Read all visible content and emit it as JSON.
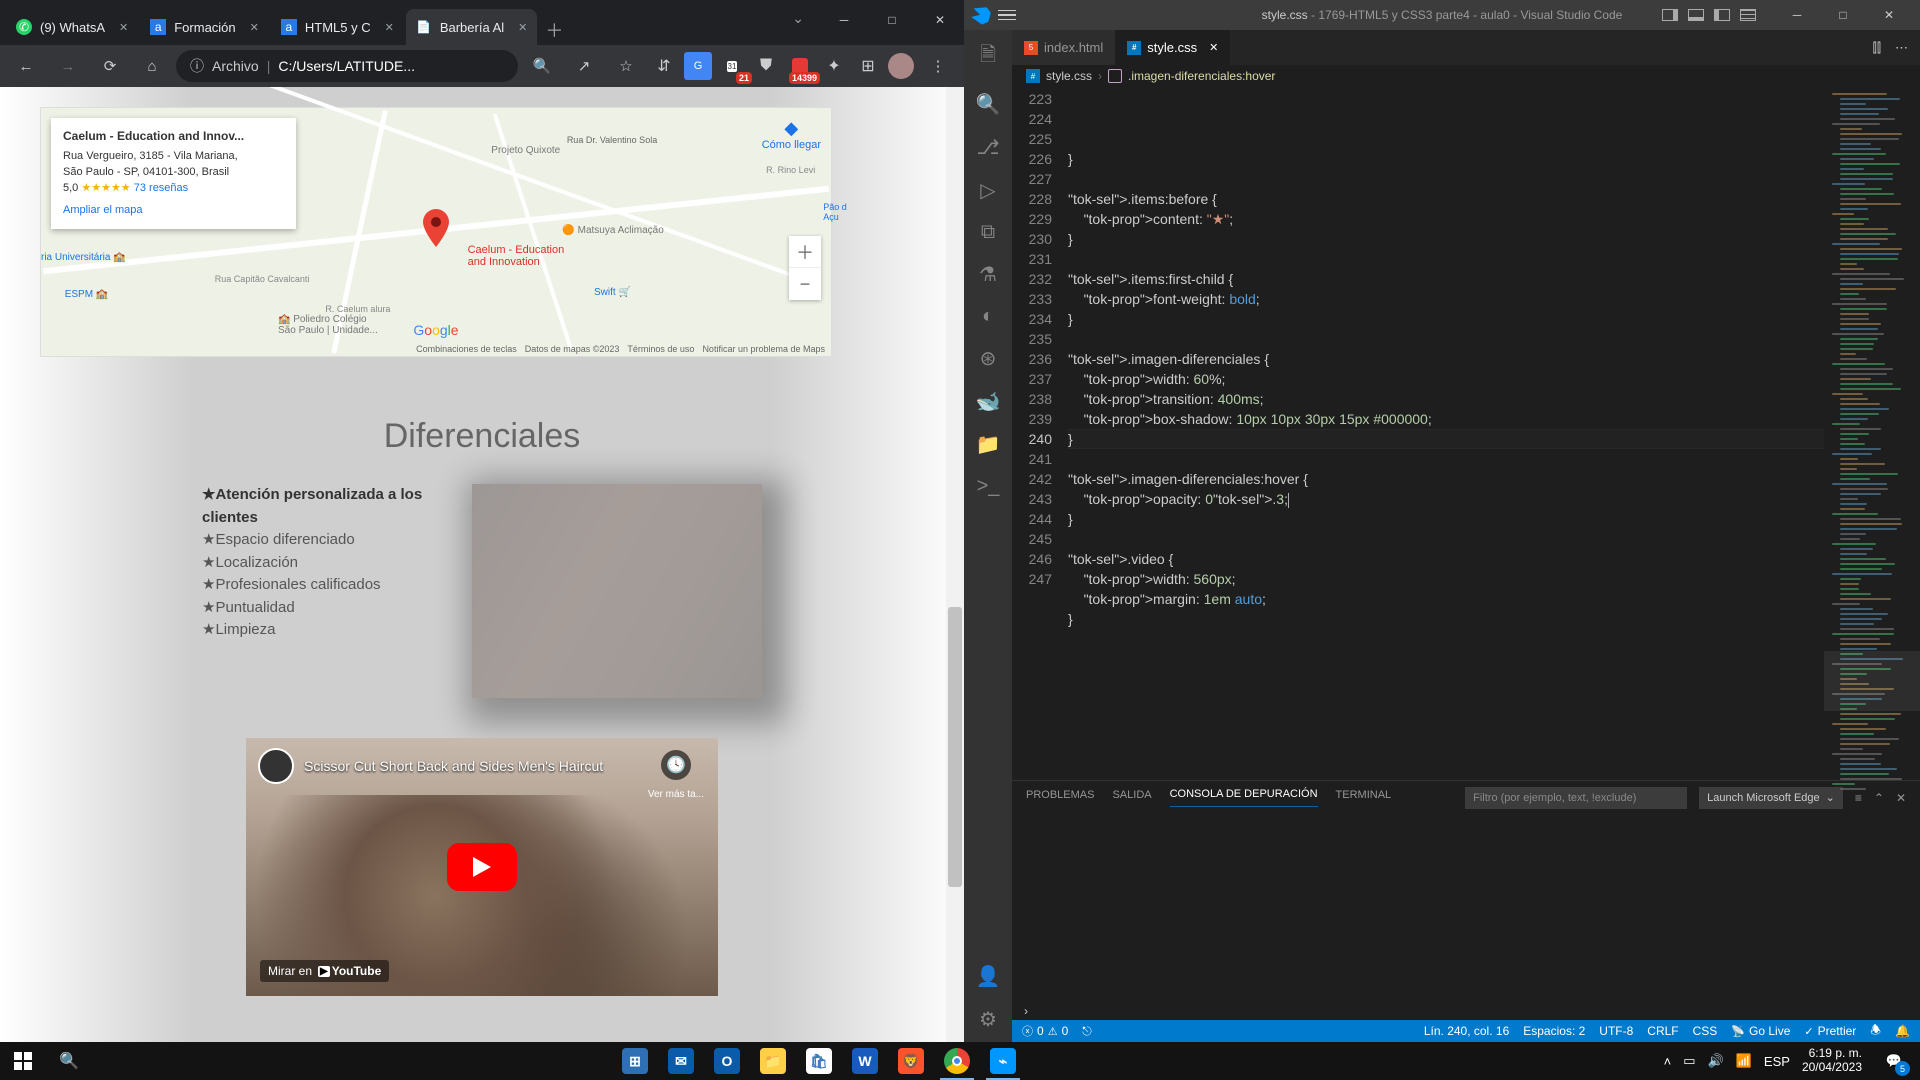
{
  "chrome": {
    "tabs": [
      {
        "title": "(9) WhatsA",
        "favicon": "green"
      },
      {
        "title": "Formación",
        "favicon": "alura"
      },
      {
        "title": "HTML5 y C",
        "favicon": "alura"
      },
      {
        "title": "Barbería Al",
        "favicon": "page",
        "active": true
      }
    ],
    "omnibox": {
      "prefix": "Archivo",
      "path": "C:/Users/LATITUDE..."
    },
    "ext_badges": {
      "cal": "21",
      "red": "14399"
    }
  },
  "page": {
    "map": {
      "card_title": "Caelum - Education and Innov...",
      "address1": "Rua Vergueiro, 3185 - Vila Mariana,",
      "address2": "São Paulo - SP, 04101-300, Brasil",
      "rating": "5,0",
      "reviews": "73 reseñas",
      "enlarge": "Ampliar el mapa",
      "directions": "Cómo llegar",
      "pin_label": "Caelum - Education\nand Innovation",
      "footer1": "Combinaciones de teclas",
      "footer2": "Datos de mapas ©2023",
      "footer3": "Términos de uso",
      "footer4": "Notificar un problema de Maps"
    },
    "dif_title": "Diferenciales",
    "items": [
      "Atención personalizada a los clientes",
      "Espacio diferenciado",
      "Localización",
      "Profesionales calificados",
      "Puntualidad",
      "Limpieza"
    ],
    "video": {
      "title": "Scissor Cut Short Back and Sides Men's Haircut",
      "later": "Ver más ta...",
      "watch": "Mirar en"
    }
  },
  "vscode": {
    "title": {
      "file": "style.css",
      "project": "1769-HTML5 y CSS3 parte4 - aula0",
      "app": "Visual Studio Code"
    },
    "tabs": [
      {
        "name": "index.html",
        "icon": "html"
      },
      {
        "name": "style.css",
        "icon": "css",
        "active": true,
        "close": true
      }
    ],
    "breadcrumb": {
      "file": "style.css",
      "selector": ".imagen-diferenciales:hover"
    },
    "code": {
      "start": 223,
      "lines": [
        "}",
        "",
        ".items:before {",
        "    content: \"★\";",
        "}",
        "",
        ".items:first-child {",
        "    font-weight: bold;",
        "}",
        "",
        ".imagen-diferenciales {",
        "    width: 60%;",
        "    transition: 400ms;",
        "    box-shadow: 10px 10px 30px 15px #000000;",
        "}",
        "",
        ".imagen-diferenciales:hover {",
        "    opacity: 0.3;",
        "}",
        "",
        ".video {",
        "    width: 560px;",
        "    margin: 1em auto;",
        "}",
        ""
      ],
      "current_line": 240
    },
    "panel": {
      "tabs": [
        "PROBLEMAS",
        "SALIDA",
        "CONSOLA DE DEPURACIÓN",
        "TERMINAL"
      ],
      "active_tab": "CONSOLA DE DEPURACIÓN",
      "filter_placeholder": "Filtro (por ejemplo, text, !exclude)",
      "launch": "Launch Microsoft Edge"
    },
    "status": {
      "errors": "0",
      "warnings": "0",
      "pos": "Lín. 240, col. 16",
      "spaces": "Espacios: 2",
      "enc": "UTF-8",
      "eol": "CRLF",
      "lang": "CSS",
      "live": "Go Live",
      "prettier": "Prettier"
    }
  },
  "taskbar": {
    "lang": "ESP",
    "time": "6:19 p. m.",
    "date": "20/04/2023",
    "notif": "5"
  }
}
